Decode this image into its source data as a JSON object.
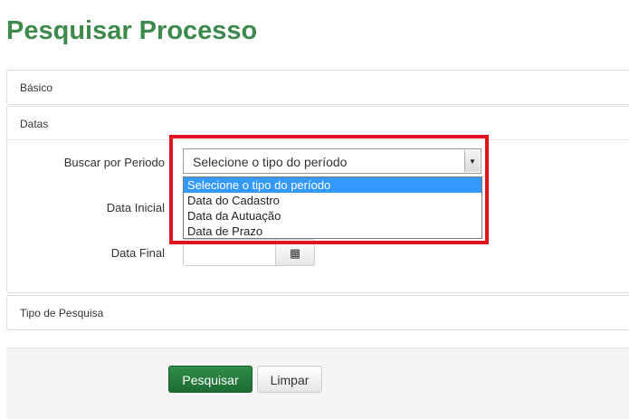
{
  "page": {
    "title": "Pesquisar Processo"
  },
  "panels": {
    "basico": "Básico",
    "datas": "Datas",
    "tipo_pesquisa": "Tipo de Pesquisa"
  },
  "form": {
    "buscar_por_periodo_label": "Buscar por Periodo",
    "data_inicial_label": "Data Inicial",
    "data_final_label": "Data Final",
    "periodo_select": {
      "value": "Selecione o tipo do período",
      "options": [
        "Selecione o tipo do período",
        "Data do Cadastro",
        "Data da Autuação",
        "Data de Prazo"
      ],
      "selected_index": 0,
      "expanded": true
    },
    "data_inicial_value": "",
    "data_final_value": ""
  },
  "icons": {
    "calendar": "calendar-icon",
    "dropdown_arrow": "caret-down-icon"
  },
  "actions": {
    "pesquisar": "Pesquisar",
    "limpar": "Limpar"
  },
  "colors": {
    "title": "#3d8a4c",
    "primary_button": "#2a8542",
    "highlight": "#e0141e",
    "selected_option": "#3399ff"
  }
}
